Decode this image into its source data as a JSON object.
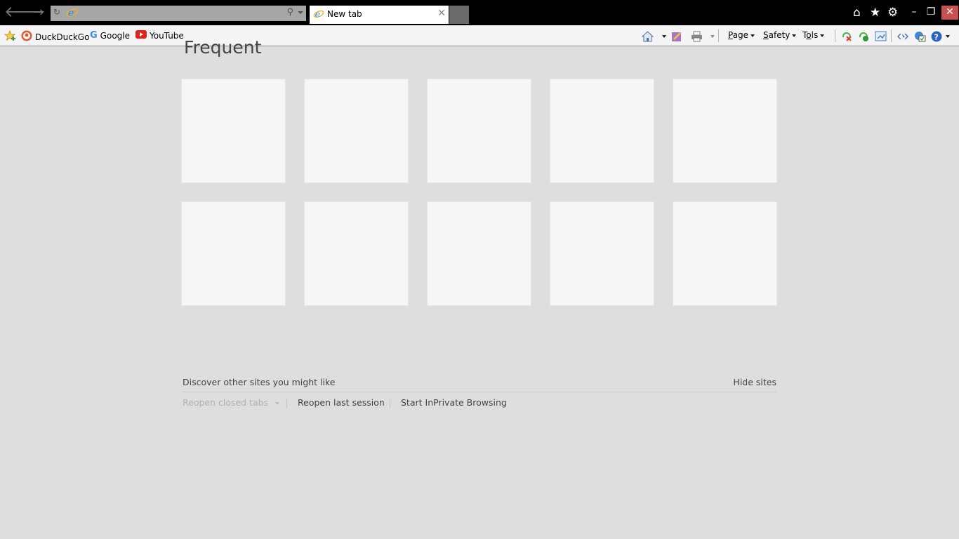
{
  "titlebar": {
    "back_icon": "arrow-left-icon",
    "forward_icon": "arrow-right-icon",
    "address": {
      "value": "",
      "refresh_icon": "refresh-icon",
      "site_icon": "ie-logo-icon",
      "search_icon": "search-icon"
    },
    "tab": {
      "title": "New tab",
      "close_glyph": "✕"
    },
    "right_icons": [
      "home-icon",
      "star-icon",
      "gear-icon"
    ],
    "window_controls": {
      "minimize": "–",
      "restore": "❐",
      "close": "✕"
    }
  },
  "favorites_bar": {
    "items": [
      {
        "label": "DuckDuckGo",
        "icon": "duckduckgo-icon"
      },
      {
        "label": "Google",
        "icon": "google-icon"
      },
      {
        "label": "YouTube",
        "icon": "youtube-icon"
      }
    ]
  },
  "command_bar": {
    "menus": [
      {
        "label": "Page",
        "accel": "P",
        "rest": "age"
      },
      {
        "label": "Safety",
        "accel": "S",
        "rest": "afety"
      },
      {
        "label": "Tools",
        "accel": "T",
        "rest": "o",
        "accel2": "o",
        "rest2": "ls"
      }
    ]
  },
  "content": {
    "heading": "Frequent",
    "tiles_count": 10,
    "discover_text": "Discover other sites you might like",
    "hide_sites": "Hide sites",
    "actions": {
      "reopen_closed": "Reopen closed tabs",
      "reopen_last": "Reopen last session",
      "inprivate": "Start InPrivate Browsing"
    }
  },
  "colors": {
    "titlebar_bg": "#000000",
    "address_bg": "#a6a6a6",
    "page_bg": "#dedede",
    "tile_bg": "#f6f6f6",
    "close_btn": "#c75050"
  }
}
